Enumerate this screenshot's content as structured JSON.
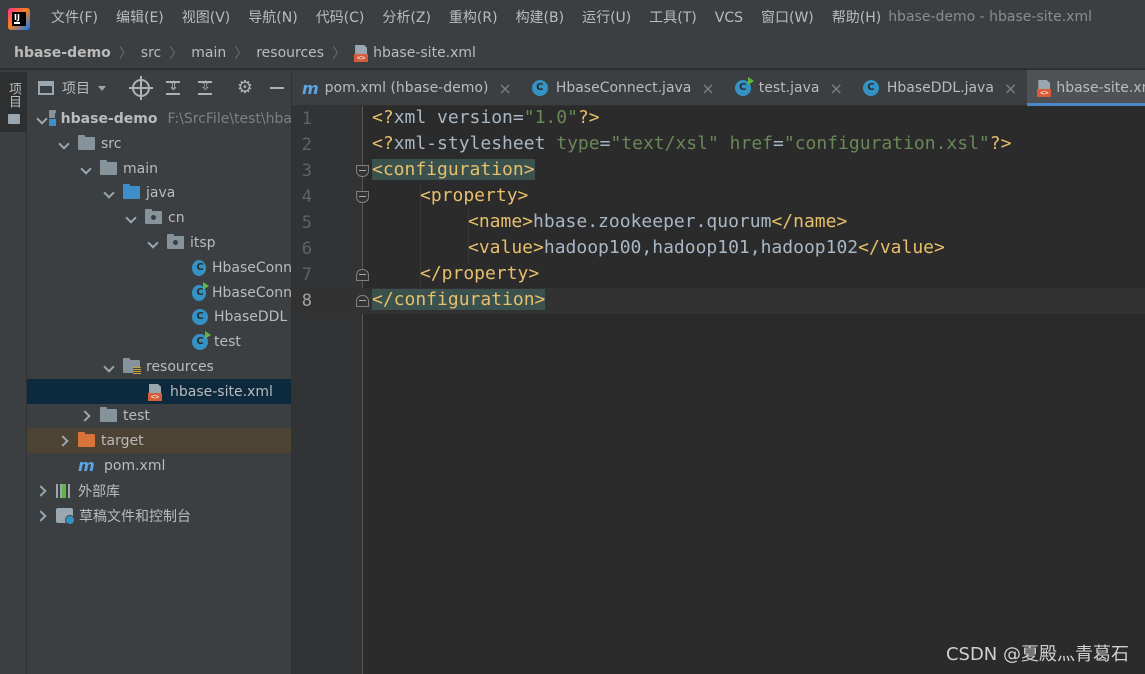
{
  "menubar": {
    "items": [
      "文件(F)",
      "编辑(E)",
      "视图(V)",
      "导航(N)",
      "代码(C)",
      "分析(Z)",
      "重构(R)",
      "构建(B)",
      "运行(U)",
      "工具(T)",
      "VCS",
      "窗口(W)",
      "帮助(H)"
    ],
    "window_title": "hbase-demo - hbase-site.xml"
  },
  "breadcrumb": [
    "hbase-demo",
    "src",
    "main",
    "resources",
    "hbase-site.xml"
  ],
  "toolstrip": {
    "project_label": "项目"
  },
  "project_panel": {
    "title": "项目",
    "tree": [
      {
        "label": "hbase-demo",
        "path": "F:\\SrcFile\\test\\hba"
      },
      {
        "label": "src"
      },
      {
        "label": "main"
      },
      {
        "label": "java"
      },
      {
        "label": "cn"
      },
      {
        "label": "itsp"
      },
      {
        "label": "HbaseConn"
      },
      {
        "label": "HbaseConn"
      },
      {
        "label": "HbaseDDL"
      },
      {
        "label": "test"
      },
      {
        "label": "resources"
      },
      {
        "label": "hbase-site.xml"
      },
      {
        "label": "test"
      },
      {
        "label": "target"
      },
      {
        "label": "pom.xml",
        "icon_text": "m"
      },
      {
        "label": "外部库"
      },
      {
        "label": "草稿文件和控制台"
      }
    ]
  },
  "tabs": [
    {
      "label": "pom.xml (hbase-demo)",
      "icon_text": "m"
    },
    {
      "label": "HbaseConnect.java"
    },
    {
      "label": "test.java"
    },
    {
      "label": "HbaseDDL.java"
    },
    {
      "label": "hbase-site.xml"
    }
  ],
  "tab_close_glyph": "×",
  "editor": {
    "line_numbers": [
      "1",
      "2",
      "3",
      "4",
      "5",
      "6",
      "7",
      "8"
    ],
    "lines": {
      "l1": {
        "a": "<?",
        "b": "xml version",
        "c": "=",
        "d": "\"1.0\"",
        "e": "?>"
      },
      "l2": {
        "a": "<?",
        "b": "xml-stylesheet ",
        "c": "type",
        "d": "=",
        "e": "\"text/xsl\"",
        "f": " href",
        "g": "=",
        "h": "\"configuration.xsl\"",
        "i": "?>"
      },
      "l3": {
        "a": "<configuration>"
      },
      "l4": {
        "a": "<property>"
      },
      "l5": {
        "a": "<name>",
        "b": "hbase.zookeeper.quorum",
        "c": "</name>"
      },
      "l6": {
        "a": "<value>",
        "b": "hadoop100,hadoop101,hadoop102",
        "c": "</value>"
      },
      "l7": {
        "a": "</property>"
      },
      "l8": {
        "a": "</configuration>"
      }
    }
  },
  "watermark": "CSDN @夏殿灬青葛石",
  "colors": {
    "tag": "#e8bf6a",
    "attr_value": "#6a8759",
    "text": "#a9b7c6",
    "selection": "#0d293e",
    "active_tab_underline": "#4a88c7"
  }
}
